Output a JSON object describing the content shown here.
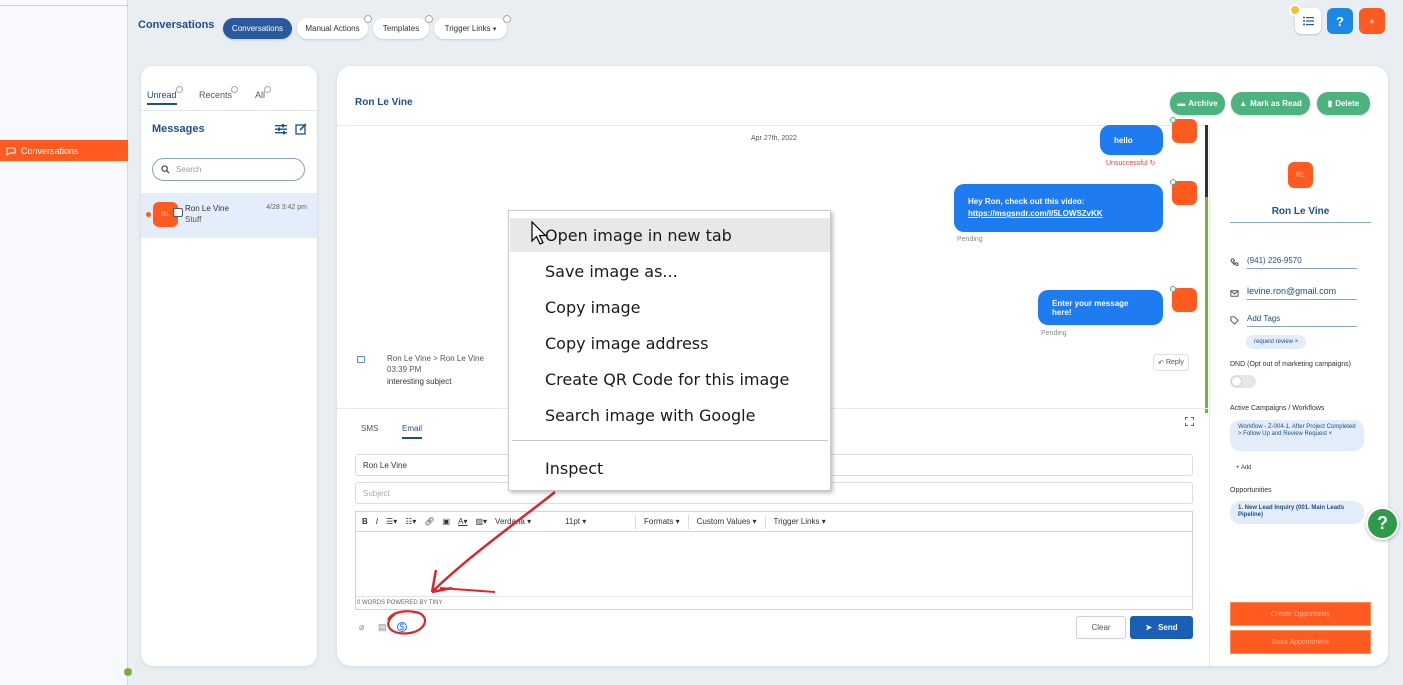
{
  "sidebar": {
    "conversations_label": "Conversations"
  },
  "header": {
    "title": "Conversations",
    "tabs": [
      {
        "label": "Conversations",
        "active": true
      },
      {
        "label": "Manual Actions",
        "active": false
      },
      {
        "label": "Templates",
        "active": false
      },
      {
        "label": "Trigger Links",
        "active": false
      }
    ],
    "help_label": "?"
  },
  "list_panel": {
    "tabs": [
      {
        "label": "Unread"
      },
      {
        "label": "Recents"
      },
      {
        "label": "All"
      }
    ],
    "heading": "Messages",
    "search_placeholder": "Search",
    "items": [
      {
        "name": "Ron Le Vine",
        "subject": "Stuff",
        "time": "4/28 3:42 pm",
        "initials": "RL"
      }
    ]
  },
  "conversation": {
    "contact_name": "Ron Le Vine",
    "actions": {
      "archive": "Archive",
      "mark_read": "Mark as Read",
      "delete": "Delete"
    },
    "date_label": "Apr 27th, 2022",
    "messages": [
      {
        "text": "hello",
        "status": "Unsuccessful"
      },
      {
        "text_line1": "Hey Ron, check out this video:",
        "link": "https://msgsndr.com/l/5LOWSZvKK",
        "status": "Pending"
      },
      {
        "text": "Enter your message here!",
        "status": "Pending"
      }
    ],
    "email": {
      "route": "Ron Le Vine > Ron Le Vine",
      "time": "03:39 PM",
      "subject": "interesting subject",
      "reply_label": "Reply"
    },
    "compose": {
      "tabs": [
        "SMS",
        "Email"
      ],
      "to_value": "Ron Le Vine",
      "subject_placeholder": "Subject",
      "font": "Verdana",
      "size": "11pt",
      "formats": "Formats",
      "custom_values": "Custom Values",
      "trigger_links": "Trigger Links",
      "footer": "0 WORDS POWERED BY TINY",
      "clear_label": "Clear",
      "send_label": "Send"
    }
  },
  "contact": {
    "name": "Ron Le Vine",
    "phone": "(941) 226-9570",
    "email": "levine.ron@gmail.com",
    "add_tags": "Add Tags",
    "tag": "request review",
    "dnd_label": "DND (Opt out of marketing campaigns)",
    "campaigns_label": "Active Campaigns / Workflows",
    "workflow": "Workflow - Z-004-1. After Project Completed > Follow Up and Review Request",
    "add_label": "Add",
    "opportunities_label": "Opportunities",
    "opportunity": "1. New Lead Inquiry (001. Main Leads Pipeline)",
    "btn1": "Create Opportunity",
    "btn2": "Book Appointment"
  },
  "context_menu": {
    "items": [
      "Open image in new tab",
      "Save image as...",
      "Copy image",
      "Copy image address",
      "Create QR Code for this image",
      "Search image with Google"
    ],
    "inspect": "Inspect"
  },
  "colors": {
    "brand_orange": "#ff5a1f",
    "primary_blue": "#1f4f87",
    "bubble_blue": "#1e7bf0",
    "success_green": "#4cb37f",
    "annotation_red": "#d9262b"
  }
}
